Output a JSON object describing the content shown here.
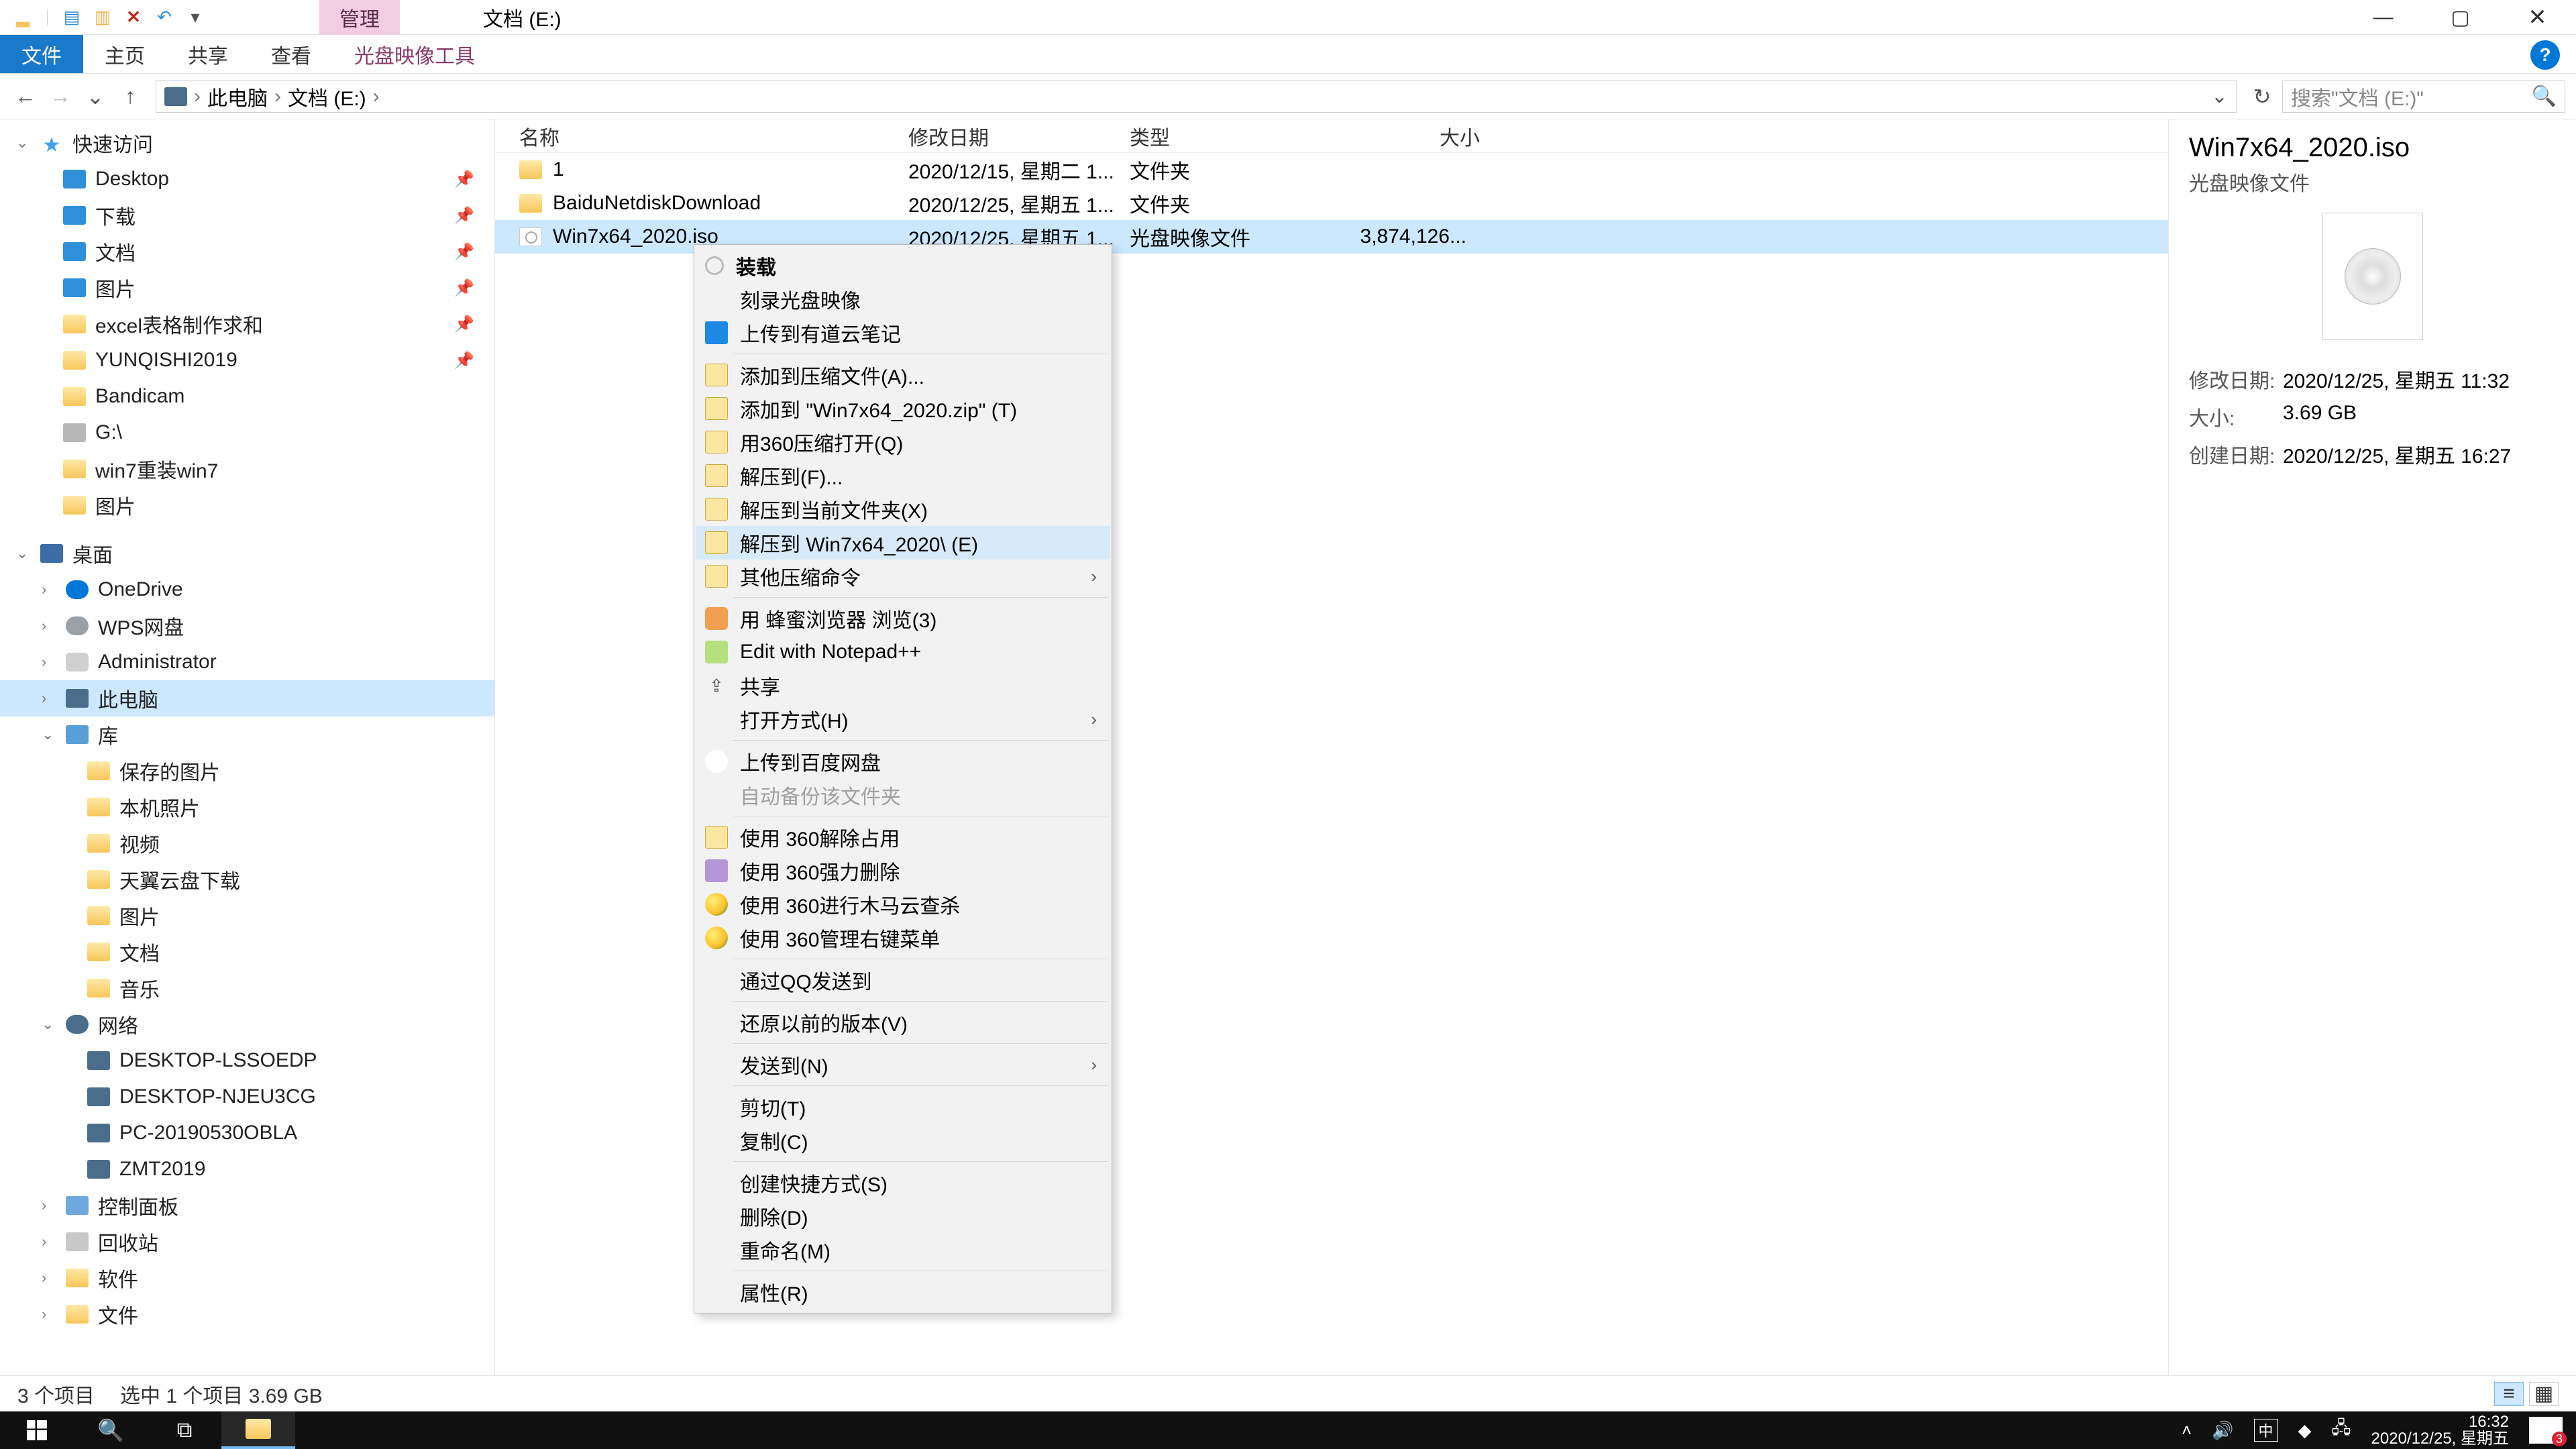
{
  "window": {
    "title": "文档 (E:)",
    "context_tab": "管理",
    "min": "—",
    "max": "▢",
    "close": "✕",
    "help": "?"
  },
  "ribbon": {
    "file": "文件",
    "tabs": [
      "主页",
      "共享",
      "查看"
    ],
    "context_tool": "光盘映像工具"
  },
  "addr": {
    "back": "←",
    "fwd": "→",
    "up": "↑",
    "crumbs": [
      "此电脑",
      "文档 (E:)"
    ],
    "sep": "›",
    "dd": "⌄",
    "refresh": "↻"
  },
  "search": {
    "placeholder": "搜索\"文档 (E:)\""
  },
  "tree": {
    "quick": {
      "label": "快速访问",
      "children": [
        {
          "label": "Desktop",
          "icon": "blue",
          "pin": true
        },
        {
          "label": "下载",
          "icon": "blue",
          "pin": true
        },
        {
          "label": "文档",
          "icon": "blue",
          "pin": true
        },
        {
          "label": "图片",
          "icon": "blue",
          "pin": true
        },
        {
          "label": "excel表格制作求和",
          "icon": "folder",
          "pin": true
        },
        {
          "label": "YUNQISHI2019",
          "icon": "folder",
          "pin": true
        },
        {
          "label": "Bandicam",
          "icon": "folder"
        },
        {
          "label": "G:\\",
          "icon": "drive"
        },
        {
          "label": "win7重装win7",
          "icon": "folder"
        },
        {
          "label": "图片",
          "icon": "folder"
        }
      ]
    },
    "desktop": {
      "label": "桌面",
      "children": [
        {
          "label": "OneDrive",
          "icon": "blue-cloud"
        },
        {
          "label": "WPS网盘",
          "icon": "gray-cloud"
        },
        {
          "label": "Administrator",
          "icon": "user"
        },
        {
          "label": "此电脑",
          "icon": "pc",
          "selected": true
        },
        {
          "label": "库",
          "icon": "lib",
          "children": [
            {
              "label": "保存的图片",
              "icon": "folder"
            },
            {
              "label": "本机照片",
              "icon": "folder"
            },
            {
              "label": "视频",
              "icon": "folder"
            },
            {
              "label": "天翼云盘下载",
              "icon": "folder"
            },
            {
              "label": "图片",
              "icon": "folder"
            },
            {
              "label": "文档",
              "icon": "folder"
            },
            {
              "label": "音乐",
              "icon": "folder"
            }
          ]
        },
        {
          "label": "网络",
          "icon": "net",
          "children": [
            {
              "label": "DESKTOP-LSSOEDP",
              "icon": "pc"
            },
            {
              "label": "DESKTOP-NJEU3CG",
              "icon": "pc"
            },
            {
              "label": "PC-20190530OBLA",
              "icon": "pc"
            },
            {
              "label": "ZMT2019",
              "icon": "pc"
            }
          ]
        },
        {
          "label": "控制面板",
          "icon": "cp"
        },
        {
          "label": "回收站",
          "icon": "bin"
        },
        {
          "label": "软件",
          "icon": "folder"
        },
        {
          "label": "文件",
          "icon": "folder"
        }
      ]
    }
  },
  "columns": {
    "name": "名称",
    "date": "修改日期",
    "type": "类型",
    "size": "大小"
  },
  "rows": [
    {
      "name": "1",
      "date": "2020/12/15, 星期二 1...",
      "type": "文件夹",
      "size": "",
      "icon": "folder"
    },
    {
      "name": "BaiduNetdiskDownload",
      "date": "2020/12/25, 星期五 1...",
      "type": "文件夹",
      "size": "",
      "icon": "folder"
    },
    {
      "name": "Win7x64_2020.iso",
      "date": "2020/12/25, 星期五 1...",
      "type": "光盘映像文件",
      "size": "3,874,126...",
      "icon": "iso",
      "selected": true
    }
  ],
  "context_menu": {
    "groups": [
      [
        {
          "label": "装载",
          "icon": "disc",
          "bold": true
        },
        {
          "label": "刻录光盘映像",
          "icon": "none"
        },
        {
          "label": "上传到有道云笔记",
          "icon": "note"
        }
      ],
      [
        {
          "label": "添加到压缩文件(A)...",
          "icon": "archive"
        },
        {
          "label": "添加到 \"Win7x64_2020.zip\" (T)",
          "icon": "archive"
        },
        {
          "label": "用360压缩打开(Q)",
          "icon": "archive"
        },
        {
          "label": "解压到(F)...",
          "icon": "archive"
        },
        {
          "label": "解压到当前文件夹(X)",
          "icon": "archive"
        },
        {
          "label": "解压到 Win7x64_2020\\ (E)",
          "icon": "archive",
          "hover": true
        },
        {
          "label": "其他压缩命令",
          "icon": "archive",
          "submenu": true
        }
      ],
      [
        {
          "label": "用 蜂蜜浏览器 浏览(3)",
          "icon": "bee"
        },
        {
          "label": "Edit with Notepad++",
          "icon": "npp"
        },
        {
          "label": "共享",
          "icon": "share",
          "glyph": "⇪"
        },
        {
          "label": "打开方式(H)",
          "icon": "none",
          "submenu": true
        }
      ],
      [
        {
          "label": "上传到百度网盘",
          "icon": "baidu"
        },
        {
          "label": "自动备份该文件夹",
          "icon": "none",
          "disabled": true
        }
      ],
      [
        {
          "label": "使用 360解除占用",
          "icon": "archive"
        },
        {
          "label": "使用 360强力删除",
          "icon": "purple"
        },
        {
          "label": "使用 360进行木马云查杀",
          "icon": "ball360"
        },
        {
          "label": "使用 360管理右键菜单",
          "icon": "ball360"
        }
      ],
      [
        {
          "label": "通过QQ发送到",
          "icon": "none"
        }
      ],
      [
        {
          "label": "还原以前的版本(V)",
          "icon": "none"
        }
      ],
      [
        {
          "label": "发送到(N)",
          "icon": "none",
          "submenu": true
        }
      ],
      [
        {
          "label": "剪切(T)",
          "icon": "none"
        },
        {
          "label": "复制(C)",
          "icon": "none"
        }
      ],
      [
        {
          "label": "创建快捷方式(S)",
          "icon": "none"
        },
        {
          "label": "删除(D)",
          "icon": "none"
        },
        {
          "label": "重命名(M)",
          "icon": "none"
        }
      ],
      [
        {
          "label": "属性(R)",
          "icon": "none"
        }
      ]
    ]
  },
  "details": {
    "title": "Win7x64_2020.iso",
    "subtitle": "光盘映像文件",
    "rows": [
      {
        "k": "修改日期:",
        "v": "2020/12/25, 星期五 11:32"
      },
      {
        "k": "大小:",
        "v": "3.69 GB"
      },
      {
        "k": "创建日期:",
        "v": "2020/12/25, 星期五 16:27"
      }
    ]
  },
  "status": {
    "count": "3 个项目",
    "selection": "选中 1 个项目  3.69 GB"
  },
  "taskbar": {
    "time": "16:32",
    "date": "2020/12/25, 星期五",
    "notif_badge": "3",
    "ime": "中"
  }
}
